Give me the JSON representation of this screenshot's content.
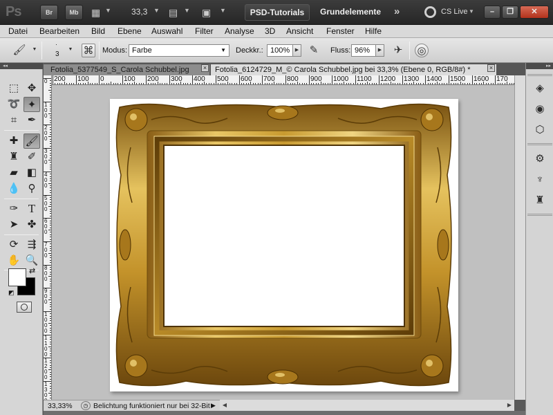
{
  "app": {
    "logo": "Ps",
    "bridge_label": "Br",
    "minibridge_label": "Mb",
    "zoom_level": "33,3",
    "psd_tutorials_label": "PSD-Tutorials",
    "workspace_label": "Grundelemente",
    "more_workspaces": "»",
    "cs_live_label": "CS Live",
    "window_controls": {
      "minimize": "–",
      "restore": "❐",
      "close": "✕"
    }
  },
  "menu": {
    "items": [
      "Datei",
      "Bearbeiten",
      "Bild",
      "Ebene",
      "Auswahl",
      "Filter",
      "Analyse",
      "3D",
      "Ansicht",
      "Fenster",
      "Hilfe"
    ]
  },
  "options": {
    "brush_size": "3",
    "mode_label": "Modus:",
    "mode_value": "Farbe",
    "opacity_label": "Deckkr.:",
    "opacity_value": "100%",
    "flow_label": "Fluss:",
    "flow_value": "96%"
  },
  "tabs": [
    {
      "label": "Fotolia_5377549_S_Carola Schubbel.jpg",
      "active": false
    },
    {
      "label": "Fotolia_6124729_M_© Carola Schubbel.jpg bei 33,3% (Ebene 0, RGB/8#) *",
      "active": true
    }
  ],
  "ruler": {
    "h_labels": [
      "200",
      "100",
      "0",
      "100",
      "200",
      "300",
      "400",
      "500",
      "600",
      "700",
      "800",
      "900",
      "1000",
      "1100",
      "1200",
      "1300",
      "1400",
      "1500",
      "1600",
      "170"
    ],
    "v_labels": [
      "0",
      "1 0 0",
      "2 0 0",
      "3 0 0",
      "4 0 0",
      "5 0 0",
      "6 0 0",
      "7 0 0",
      "8 0 0",
      "9 0 0",
      "1 0 0 0",
      "1 1 0 0",
      "1 2 0 0",
      "1 3 0 0"
    ]
  },
  "status": {
    "zoom": "33,33%",
    "message": "Belichtung funktioniert nur bei 32-Bit"
  },
  "colors": {
    "foreground": "#ffffff",
    "background": "#000000",
    "gold_light": "#f3d47a",
    "gold_mid": "#c99a2e",
    "gold_dark": "#7a5312"
  }
}
